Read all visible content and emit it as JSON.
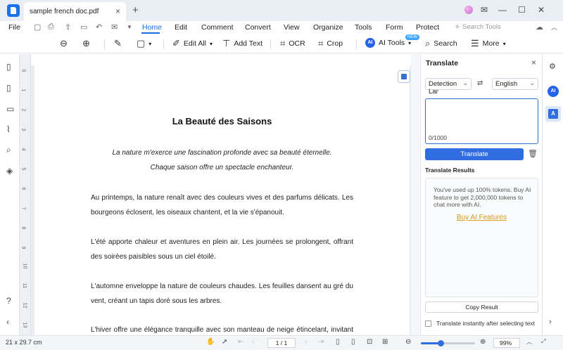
{
  "titlebar": {
    "tab_label": "sample french doc.pdf",
    "tab_close": "×",
    "new_tab": "+",
    "minimize": "—",
    "maximize": "☐",
    "close": "✕"
  },
  "menubar": {
    "file": "File",
    "items": [
      "Home",
      "Edit",
      "Comment",
      "Convert",
      "View",
      "Organize",
      "Tools",
      "Form",
      "Protect"
    ],
    "active": "Home",
    "search_tools": "Search Tools"
  },
  "toolbar": {
    "edit_all": "Edit All",
    "add_text": "Add Text",
    "ocr": "OCR",
    "crop": "Crop",
    "ai_tools": "AI Tools",
    "new_badge": "NEW",
    "search": "Search",
    "more": "More"
  },
  "document": {
    "title": "La Beauté des Saisons",
    "intro_line1": "La nature m'exerce une fascination profonde avec sa beauté éternelle.",
    "intro_line2": "Chaque saison offre un spectacle enchanteur.",
    "para1": "Au printemps, la nature renaît avec des couleurs vives et des parfums délicats. Les bourgeons éclosent, les oiseaux chantent, et la vie s'épanouit.",
    "para2": "L'été apporte chaleur et aventures en plein air. Les journées se prolongent, offrant des soirées paisibles sous un ciel étoilé.",
    "para3": "L'automne enveloppe la nature de couleurs chaudes. Les feuilles dansent au gré du vent, créant un tapis doré sous les arbres.",
    "para4": "L'hiver offre une élégance tranquille avec son manteau de neige étincelant, invitant à la"
  },
  "ruler": {
    "numbers": [
      "0",
      "1",
      "2",
      "3",
      "4",
      "5",
      "6",
      "7",
      "8",
      "9",
      "10",
      "11",
      "12",
      "13"
    ]
  },
  "translate_panel": {
    "title": "Translate",
    "close": "×",
    "source_lang": "Detection Lar",
    "target_lang": "English",
    "char_count": "0/1000",
    "translate_button": "Translate",
    "results_label": "Translate Results",
    "results_message": "You've used up 100% tokens. Buy AI feature to get 2,000,000 tokens to chat more with AI.",
    "buy_link": "Buy AI Features",
    "copy_button": "Copy Result",
    "instant_option": "Translate instantly after selecting text"
  },
  "statusbar": {
    "page_size": "21 x 29.7 cm",
    "page_indicator": "1 / 1",
    "zoom": "99%",
    "zoom_fraction": 0.37
  },
  "icons": {
    "ai": "AI",
    "colors": {
      "accent": "#1a6fe0",
      "link": "#d39a16",
      "button": "#2f6de1"
    }
  }
}
